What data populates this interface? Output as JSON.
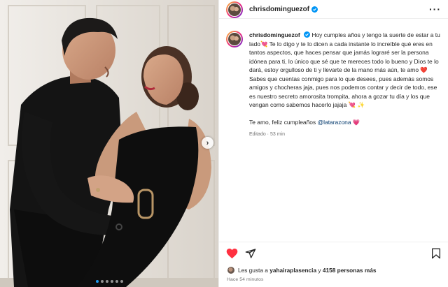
{
  "post": {
    "username": "chrisdominguezof",
    "more_icon": "more-icon",
    "carousel": {
      "dot_count": 6,
      "active_dot": 0
    }
  },
  "caption": {
    "username": "chrisdominguezof",
    "line1": "Hoy cumples años y tengo la suerte de estar a tu lado",
    "line1_emoji": "💘",
    "line2": "Te lo digo y te lo dicen a cada instante lo increíble qué eres en tantos aspectos, que haces pensar que jamás lograré ser la persona idónea para ti, lo único que sé que te mereces todo lo bueno y Dios te lo dará, estoy orgulloso de ti y llevarte de la mano más aún, te amo",
    "line2_emoji": "❤️",
    "para2": "Sabes que cuentas conmigo para lo que desees, pues además somos amigos y chocheras jaja, pues nos podemos contar y decir de todo, ese es nuestro secreto amorosita trompita, ahora a gozar tu día y los que vengan como sabemos hacerlo jajaja",
    "para2_emoji1": "💘",
    "para2_emoji2": "✨",
    "para3": "Te amo, feliz cumpleaños",
    "para3_mention": "@latarazona",
    "para3_emoji": "💗",
    "edited": "Editado · 53 min"
  },
  "engagement": {
    "likes_prefix": "Les gusta a",
    "likes_user": "yahairaplasencia",
    "likes_middle": "y",
    "likes_count": "4158 personas más",
    "timestamp": "Hace 54 minutos"
  },
  "colors": {
    "verified": "#0095f6",
    "like_heart": "#ff3040",
    "mention": "#00376b"
  }
}
